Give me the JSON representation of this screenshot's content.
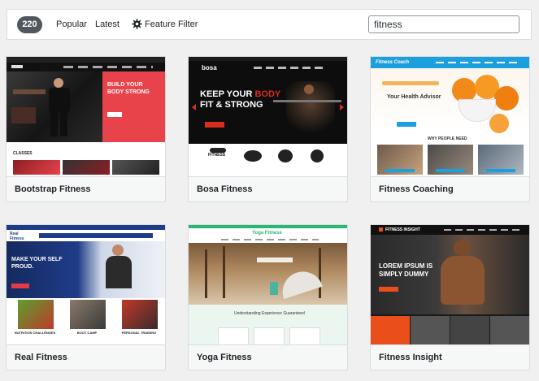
{
  "filter_bar": {
    "theme_count": "220",
    "tabs": [
      "Popular",
      "Latest"
    ],
    "feature_filter_label": "Feature Filter",
    "search_value": "fitness"
  },
  "themes": [
    {
      "name": "Bootstrap Fitness",
      "preview": {
        "headline": "BUILD YOUR BODY STRONG",
        "section": "CLASSES",
        "accent": "#e8434a"
      }
    },
    {
      "name": "Bosa Fitness",
      "preview": {
        "logo": "bosa",
        "headline_1": "KEEP YOUR",
        "headline_accent": "BODY",
        "headline_2": "FIT & STRONG",
        "badge": "FITNESS",
        "accent": "#d62d20"
      }
    },
    {
      "name": "Fitness Coaching",
      "preview": {
        "logo": "Fitness Coach",
        "tagline": "Your Health Advisor",
        "section": "WHY PEOPLE NEED",
        "accent": "#1ca0dd"
      }
    },
    {
      "name": "Real Fitness",
      "preview": {
        "logo": "Real Fitness",
        "headline": "MAKE YOUR SELF PROUD.",
        "features": [
          "NUTRITION CHALLENGES",
          "BOOT CAMP",
          "PERSONAL TRAINING"
        ],
        "accent": "#1f3c88"
      }
    },
    {
      "name": "Yoga Fitness",
      "preview": {
        "logo": "Yoga Fitness",
        "section": "Understanding Experience Guaranteed",
        "accent": "#2bb673"
      }
    },
    {
      "name": "Fitness Insight",
      "preview": {
        "logo": "FITNESS INSIGHT",
        "headline": "LOREM IPSUM IS SIMPLY DUMMY",
        "accent": "#e94e1b"
      }
    }
  ]
}
